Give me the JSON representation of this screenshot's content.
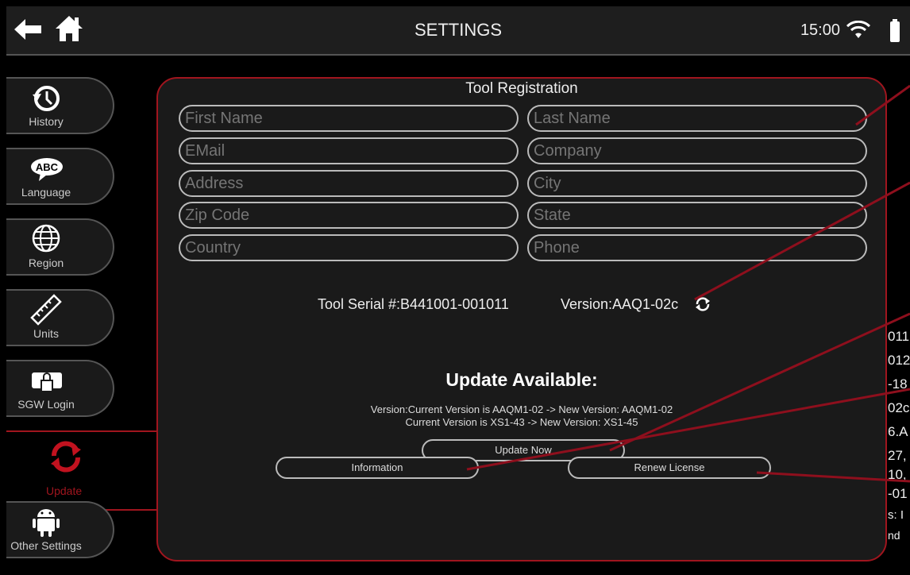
{
  "header": {
    "title": "SETTINGS",
    "time": "15:00"
  },
  "sidebar": {
    "items": [
      {
        "label": "History"
      },
      {
        "label": "Language"
      },
      {
        "label": "Region"
      },
      {
        "label": "Units"
      },
      {
        "label": "SGW Login"
      },
      {
        "label": "Update"
      },
      {
        "label": "Other Settings"
      }
    ]
  },
  "registration": {
    "title": "Tool Registration",
    "fields": [
      {
        "placeholder": "First Name"
      },
      {
        "placeholder": "Last Name"
      },
      {
        "placeholder": "EMail"
      },
      {
        "placeholder": "Company"
      },
      {
        "placeholder": "Address"
      },
      {
        "placeholder": "City"
      },
      {
        "placeholder": "Zip Code"
      },
      {
        "placeholder": "State"
      },
      {
        "placeholder": "Country"
      },
      {
        "placeholder": "Phone"
      }
    ],
    "serial": "Tool Serial #:B441001-001011",
    "version": "Version:AAQ1-02c"
  },
  "update": {
    "title": "Update Available:",
    "line1": "Version:Current Version is AAQM1-02 -> New Version: AAQM1-02",
    "line2": "Current Version is XS1-43 -> New Version: XS1-45",
    "update_now": "Update Now",
    "information": "Information",
    "renew_license": "Renew License"
  },
  "background_text": [
    "011",
    "012",
    "-18",
    "02c",
    "6.A",
    "27,",
    "10,",
    "-01",
    "s: I",
    "nd"
  ],
  "colors": {
    "accent": "#a0151e",
    "background": "#000000",
    "panel": "#1a1a1a"
  }
}
